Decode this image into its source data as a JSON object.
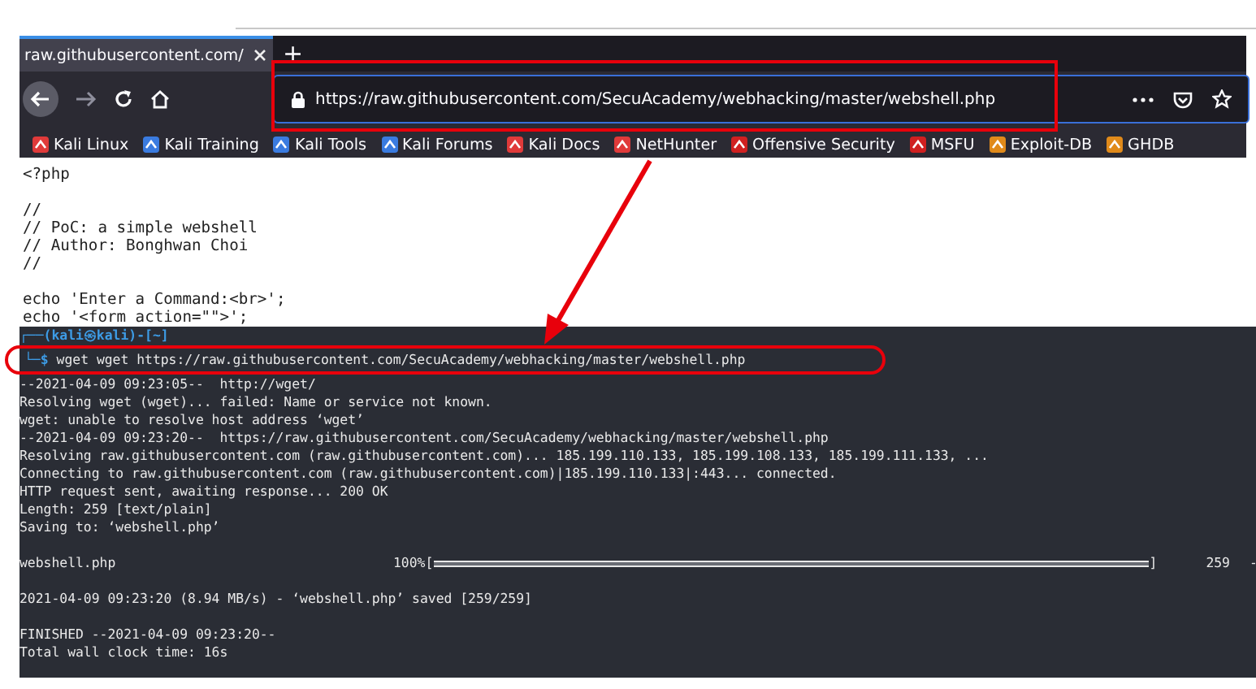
{
  "browser": {
    "tab": {
      "title": "raw.githubusercontent.com/",
      "selected": true
    },
    "new_tab": "+",
    "url": "https://raw.githubusercontent.com/SecuAcademy/webhacking/master/webshell.php",
    "bookmarks": [
      {
        "label": "Kali Linux",
        "color": "#e03a3a"
      },
      {
        "label": "Kali Training",
        "color": "#3a7be0"
      },
      {
        "label": "Kali Tools",
        "color": "#3a7be0"
      },
      {
        "label": "Kali Forums",
        "color": "#3a7be0"
      },
      {
        "label": "Kali Docs",
        "color": "#e03a3a"
      },
      {
        "label": "NetHunter",
        "color": "#e03a3a"
      },
      {
        "label": "Offensive Security",
        "color": "#d02020"
      },
      {
        "label": "MSFU",
        "color": "#d02020"
      },
      {
        "label": "Exploit-DB",
        "color": "#e08a1a"
      },
      {
        "label": "GHDB",
        "color": "#e08a1a"
      }
    ]
  },
  "page_source": {
    "lines": [
      {
        "kind": "code",
        "text": "<?php"
      },
      {
        "kind": "blank"
      },
      {
        "kind": "code",
        "text": "//"
      },
      {
        "kind": "code",
        "text": "// PoC: a simple webshell"
      },
      {
        "kind": "code",
        "text": "// Author: Bonghwan Choi"
      },
      {
        "kind": "code",
        "text": "//"
      },
      {
        "kind": "blank"
      },
      {
        "kind": "code",
        "text": "echo 'Enter a Command:<br>';"
      },
      {
        "kind": "code",
        "text": "echo '<form action=\"\">';"
      }
    ]
  },
  "terminal": {
    "prompt": "┌──(kali㉿kali)-[~]",
    "prompt_end": "└─$",
    "command": "wget wget https://raw.githubusercontent.com/SecuAcademy/webhacking/master/webshell.php",
    "lines": [
      {
        "kind": "text",
        "text": "--2021-04-09 09:23:05--  http://wget/"
      },
      {
        "kind": "text",
        "text": "Resolving wget (wget)... failed: Name or service not known."
      },
      {
        "kind": "text",
        "text": "wget: unable to resolve host address ‘wget’"
      },
      {
        "kind": "text",
        "text": "--2021-04-09 09:23:20--  https://raw.githubusercontent.com/SecuAcademy/webhacking/master/webshell.php"
      },
      {
        "kind": "text",
        "text": "Resolving raw.githubusercontent.com (raw.githubusercontent.com)... 185.199.110.133, 185.199.108.133, 185.199.111.133, ..."
      },
      {
        "kind": "text",
        "text": "Connecting to raw.githubusercontent.com (raw.githubusercontent.com)|185.199.110.133|:443... connected."
      },
      {
        "kind": "text",
        "text": "HTTP request sent, awaiting response... 200 OK"
      },
      {
        "kind": "text",
        "text": "Length: 259 [text/plain]"
      },
      {
        "kind": "text",
        "text": "Saving to: ‘webshell.php’"
      },
      {
        "kind": "blank"
      },
      {
        "kind": "progress",
        "file": "webshell.php",
        "percent": "100%[",
        "level": 1,
        "end": "]",
        "size": "259",
        "tail": "-"
      },
      {
        "kind": "blank"
      },
      {
        "kind": "text",
        "text": "2021-04-09 09:23:20 (8.94 MB/s) - ‘webshell.php’ saved [259/259]"
      },
      {
        "kind": "blank"
      },
      {
        "kind": "text",
        "text": "FINISHED --2021-04-09 09:23:20--"
      },
      {
        "kind": "text",
        "text": "Total wall clock time: 16s"
      }
    ]
  }
}
